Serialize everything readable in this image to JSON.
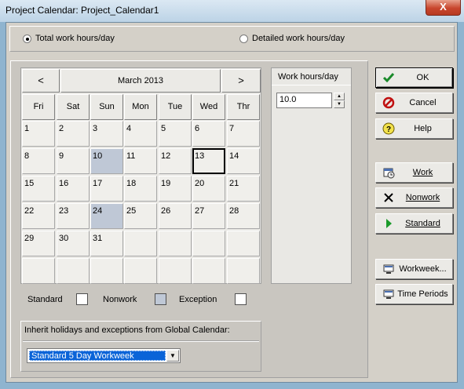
{
  "window": {
    "title": "Project Calendar: Project_Calendar1",
    "close_label": "X"
  },
  "mode": {
    "options": [
      {
        "label": "Total work hours/day",
        "selected": true
      },
      {
        "label": "Detailed work hours/day",
        "selected": false
      }
    ]
  },
  "calendar": {
    "prev_label": "<",
    "next_label": ">",
    "month": "March 2013",
    "weekdays": [
      "Fri",
      "Sat",
      "Sun",
      "Mon",
      "Tue",
      "Wed",
      "Thr"
    ],
    "weeks": [
      [
        {
          "d": "1"
        },
        {
          "d": "2"
        },
        {
          "d": "3"
        },
        {
          "d": "4"
        },
        {
          "d": "5"
        },
        {
          "d": "6"
        },
        {
          "d": "7"
        }
      ],
      [
        {
          "d": "8"
        },
        {
          "d": "9"
        },
        {
          "d": "10",
          "t": "nonwork"
        },
        {
          "d": "11"
        },
        {
          "d": "12"
        },
        {
          "d": "13",
          "t": "today"
        },
        {
          "d": "14"
        }
      ],
      [
        {
          "d": "15"
        },
        {
          "d": "16"
        },
        {
          "d": "17"
        },
        {
          "d": "18"
        },
        {
          "d": "19"
        },
        {
          "d": "20"
        },
        {
          "d": "21"
        }
      ],
      [
        {
          "d": "22"
        },
        {
          "d": "23"
        },
        {
          "d": "24",
          "t": "nonwork"
        },
        {
          "d": "25"
        },
        {
          "d": "26"
        },
        {
          "d": "27"
        },
        {
          "d": "28"
        }
      ],
      [
        {
          "d": "29"
        },
        {
          "d": "30"
        },
        {
          "d": "31"
        },
        {
          "d": ""
        },
        {
          "d": ""
        },
        {
          "d": ""
        },
        {
          "d": ""
        }
      ],
      [
        {
          "d": ""
        },
        {
          "d": ""
        },
        {
          "d": ""
        },
        {
          "d": ""
        },
        {
          "d": ""
        },
        {
          "d": ""
        },
        {
          "d": ""
        }
      ]
    ]
  },
  "work_hours": {
    "header": "Work hours/day",
    "value": "10.0"
  },
  "legend": {
    "standard": "Standard",
    "nonwork": "Nonwork",
    "exception": "Exception",
    "colors": {
      "standard": "#ffffff",
      "nonwork": "#bfc8d6",
      "exception": "#ffffff"
    }
  },
  "inherit": {
    "label": "Inherit holidays and exceptions from Global Calendar:",
    "selected": "Standard 5 Day Workweek"
  },
  "buttons": {
    "ok": "OK",
    "cancel": "Cancel",
    "help": "Help",
    "work": "Work",
    "nonwork": "Nonwork",
    "standard": "Standard",
    "workweek": "Workweek...",
    "time_periods": "Time Periods"
  },
  "icons": {
    "ok": "check-icon",
    "cancel": "cancel-icon",
    "help": "help-icon",
    "work": "work-calendar-icon",
    "nonwork": "x-icon",
    "standard": "play-triangle-icon",
    "workweek": "monitor-icon",
    "time_periods": "monitor-icon"
  }
}
